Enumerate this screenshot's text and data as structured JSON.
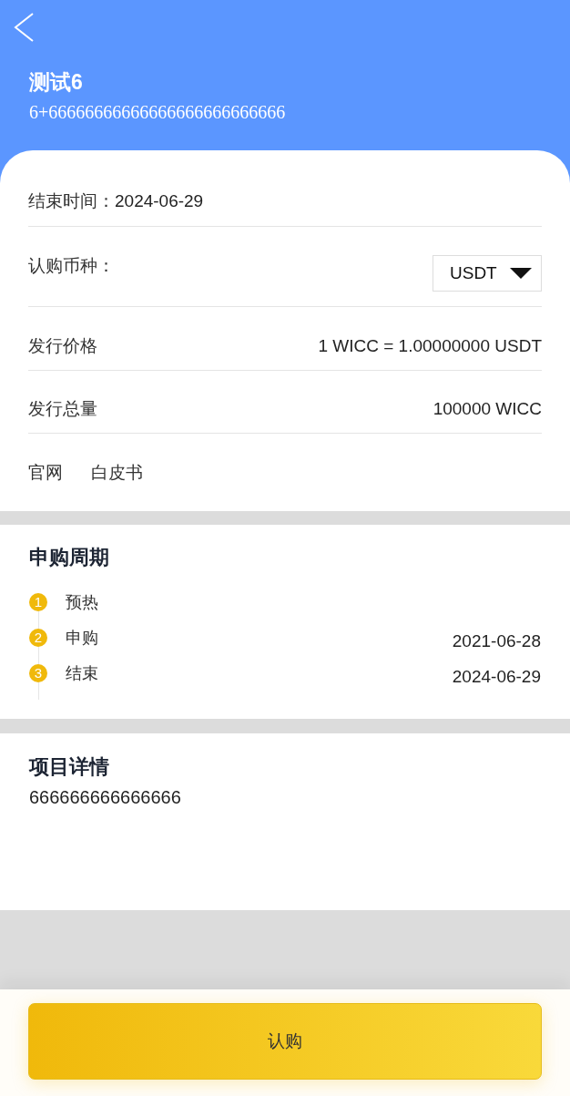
{
  "header": {
    "title": "测试6",
    "subtitle": "6+66666666666666666666666666"
  },
  "info_rows": [
    {
      "kind": "inline",
      "label": "结束时间：",
      "value": "2024-06-29"
    },
    {
      "kind": "select",
      "label": "认购币种：",
      "value": "USDT"
    },
    {
      "kind": "pair",
      "label": "发行价格",
      "value": "1 WICC = 1.00000000 USDT"
    },
    {
      "kind": "pair",
      "label": "发行总量",
      "value": "100000 WICC"
    },
    {
      "kind": "links",
      "links": [
        "官网",
        "白皮书"
      ]
    }
  ],
  "subscription_period": {
    "title": "申购周期",
    "steps": [
      {
        "number": "1",
        "label": "预热"
      },
      {
        "number": "2",
        "label": "申购",
        "date": "2021-06-28"
      },
      {
        "number": "3",
        "label": "结束",
        "date": "2024-06-29"
      }
    ]
  },
  "project_details": {
    "title": "项目详情",
    "text": "666666666666666"
  },
  "subscribe_button": "认购"
}
